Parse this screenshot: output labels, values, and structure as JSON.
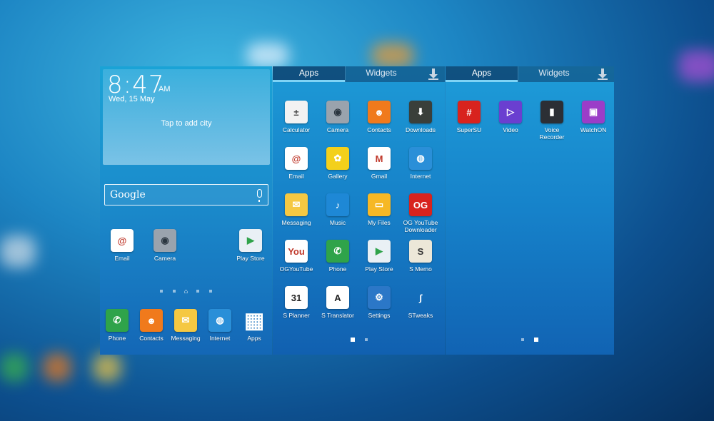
{
  "home": {
    "time": "8:47",
    "ampm": "AM",
    "date": "Wed, 15 May",
    "weather_prompt": "Tap to add city",
    "search_logo": "Google",
    "apps": [
      {
        "label": "Email",
        "icon": "email-icon",
        "glyph": "@",
        "color": "#ffffff"
      },
      {
        "label": "Camera",
        "icon": "camera-icon",
        "glyph": "◉",
        "color": "#9aa3ad"
      },
      {
        "label": "Play Store",
        "icon": "play-store-icon",
        "glyph": "▶",
        "color": "#e9f0f5"
      }
    ],
    "dock": [
      {
        "label": "Phone",
        "icon": "phone-icon",
        "glyph": "✆",
        "color": "#2fa34a"
      },
      {
        "label": "Contacts",
        "icon": "contacts-icon",
        "glyph": "☻",
        "color": "#f07a1c"
      },
      {
        "label": "Messaging",
        "icon": "messaging-icon",
        "glyph": "✉",
        "color": "#f5c842"
      },
      {
        "label": "Internet",
        "icon": "internet-icon",
        "glyph": "◍",
        "color": "#2a8fd8"
      },
      {
        "label": "Apps",
        "icon": "apps-grid-icon",
        "glyph": "▦",
        "color": "transparent"
      }
    ]
  },
  "drawer": {
    "tab_apps": "Apps",
    "tab_widgets": "Widgets",
    "page1": [
      {
        "label": "Calculator",
        "icon": "calculator-icon",
        "glyph": "±",
        "color": "#f2f2f2"
      },
      {
        "label": "Camera",
        "icon": "camera-icon",
        "glyph": "◉",
        "color": "#9aa3ad"
      },
      {
        "label": "Contacts",
        "icon": "contacts-icon",
        "glyph": "☻",
        "color": "#f07a1c"
      },
      {
        "label": "Downloads",
        "icon": "downloads-icon",
        "glyph": "⬇",
        "color": "#3a3f3a"
      },
      {
        "label": "Email",
        "icon": "email-icon",
        "glyph": "@",
        "color": "#ffffff"
      },
      {
        "label": "Gallery",
        "icon": "gallery-icon",
        "glyph": "✿",
        "color": "#f3d01b"
      },
      {
        "label": "Gmail",
        "icon": "gmail-icon",
        "glyph": "M",
        "color": "#ffffff"
      },
      {
        "label": "Internet",
        "icon": "internet-icon",
        "glyph": "◍",
        "color": "#2a8fd8"
      },
      {
        "label": "Messaging",
        "icon": "messaging-icon",
        "glyph": "✉",
        "color": "#f5c842"
      },
      {
        "label": "Music",
        "icon": "music-icon",
        "glyph": "♪",
        "color": "#1e88d6"
      },
      {
        "label": "My Files",
        "icon": "my-files-icon",
        "glyph": "▭",
        "color": "#f6b825"
      },
      {
        "label": "OG YouTube Downloader",
        "icon": "og-youtube-downloader-icon",
        "glyph": "OG",
        "color": "#d8231e"
      },
      {
        "label": "OGYouTube",
        "icon": "og-youtube-icon",
        "glyph": "You",
        "color": "#ffffff"
      },
      {
        "label": "Phone",
        "icon": "phone-icon",
        "glyph": "✆",
        "color": "#2fa34a"
      },
      {
        "label": "Play Store",
        "icon": "play-store-icon",
        "glyph": "▶",
        "color": "#e9f0f5"
      },
      {
        "label": "S Memo",
        "icon": "s-memo-icon",
        "glyph": "S",
        "color": "#ece7d8"
      },
      {
        "label": "S Planner",
        "icon": "s-planner-icon",
        "glyph": "31",
        "color": "#ffffff"
      },
      {
        "label": "S Translator",
        "icon": "s-translator-icon",
        "glyph": "A",
        "color": "#ffffff"
      },
      {
        "label": "Settings",
        "icon": "settings-icon",
        "glyph": "⚙",
        "color": "#2b77c7"
      },
      {
        "label": "STweaks",
        "icon": "stweaks-icon",
        "glyph": "ʃ",
        "color": "transparent"
      }
    ],
    "page2": [
      {
        "label": "SuperSU",
        "icon": "supersu-icon",
        "glyph": "#",
        "color": "#d8231e"
      },
      {
        "label": "Video",
        "icon": "video-icon",
        "glyph": "▷",
        "color": "#6a3fd0"
      },
      {
        "label": "Voice Recorder",
        "icon": "voice-recorder-icon",
        "glyph": "▮",
        "color": "#2c2f35"
      },
      {
        "label": "WatchON",
        "icon": "watchon-icon",
        "glyph": "▣",
        "color": "#9b3dc8"
      }
    ]
  },
  "colors": {
    "tab_indicator": "#7fd3f5",
    "panel_blue": "#1680c8"
  }
}
